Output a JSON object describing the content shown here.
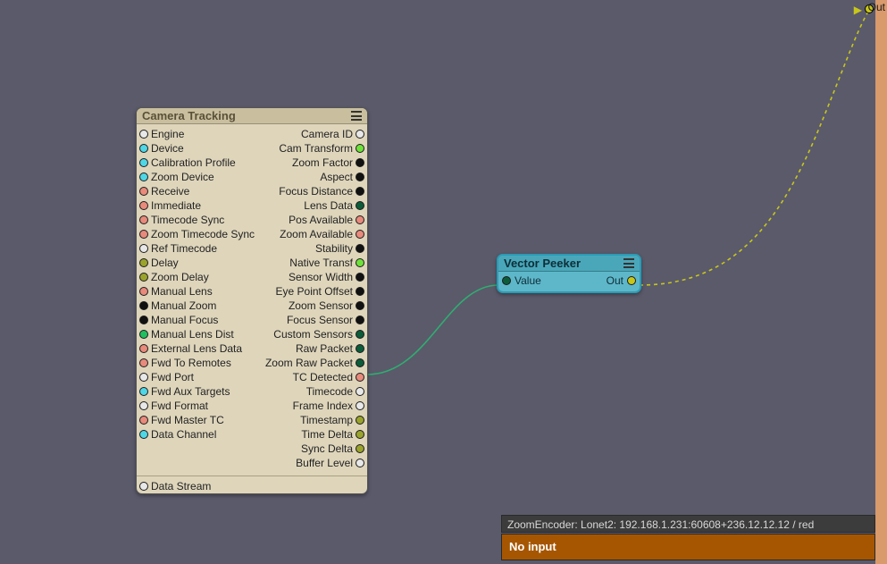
{
  "rail_out_label": "Out",
  "camera": {
    "title": "Camera Tracking",
    "rows": [
      {
        "l": "Engine",
        "lc": "white",
        "r": "Camera ID",
        "rc": "white"
      },
      {
        "l": "Device",
        "lc": "cyan",
        "r": "Cam Transform",
        "rc": "lime"
      },
      {
        "l": "Calibration Profile",
        "lc": "cyan",
        "r": "Zoom Factor",
        "rc": "black"
      },
      {
        "l": "Zoom Device",
        "lc": "cyan",
        "r": "Aspect",
        "rc": "black"
      },
      {
        "l": "Receive",
        "lc": "salmon",
        "r": "Focus Distance",
        "rc": "black"
      },
      {
        "l": "Immediate",
        "lc": "salmon",
        "r": "Lens Data",
        "rc": "dgreen"
      },
      {
        "l": "Timecode Sync",
        "lc": "salmon",
        "r": "Pos Available",
        "rc": "salmon"
      },
      {
        "l": "Zoom Timecode Sync",
        "lc": "salmon",
        "r": "Zoom Available",
        "rc": "salmon"
      },
      {
        "l": "Ref Timecode",
        "lc": "white",
        "r": "Stability",
        "rc": "black"
      },
      {
        "l": "Delay",
        "lc": "olive",
        "r": "Native Transf",
        "rc": "lime"
      },
      {
        "l": "Zoom Delay",
        "lc": "olive",
        "r": "Sensor Width",
        "rc": "black"
      },
      {
        "l": "Manual Lens",
        "lc": "salmon",
        "r": "Eye Point Offset",
        "rc": "black"
      },
      {
        "l": "Manual Zoom",
        "lc": "black",
        "r": "Zoom Sensor",
        "rc": "black"
      },
      {
        "l": "Manual Focus",
        "lc": "black",
        "r": "Focus Sensor",
        "rc": "black"
      },
      {
        "l": "Manual Lens Dist",
        "lc": "green",
        "r": "Custom Sensors",
        "rc": "dgreen"
      },
      {
        "l": "External Lens Data",
        "lc": "salmon",
        "r": "Raw Packet",
        "rc": "dgreen"
      },
      {
        "l": "Fwd To Remotes",
        "lc": "salmon",
        "r": "Zoom Raw Packet",
        "rc": "dgreen"
      },
      {
        "l": "Fwd Port",
        "lc": "white",
        "r": "TC Detected",
        "rc": "salmon"
      },
      {
        "l": "Fwd Aux Targets",
        "lc": "cyan",
        "r": "Timecode",
        "rc": "white"
      },
      {
        "l": "Fwd Format",
        "lc": "white",
        "r": "Frame Index",
        "rc": "white"
      },
      {
        "l": "Fwd Master TC",
        "lc": "salmon",
        "r": "Timestamp",
        "rc": "olive"
      },
      {
        "l": "Data Channel",
        "lc": "cyan",
        "r": "Time Delta",
        "rc": "olive"
      },
      {
        "l": "",
        "lc": "",
        "r": "Sync Delta",
        "rc": "olive"
      },
      {
        "l": "",
        "lc": "",
        "r": "Buffer Level",
        "rc": "white"
      }
    ],
    "footer_label": "Data Stream",
    "footer_color": "white"
  },
  "peeker": {
    "title": "Vector Peeker",
    "in_label": "Value",
    "in_color": "dgreen",
    "out_label": "Out",
    "out_color": "yellow"
  },
  "status_line": "ZoomEncoder: Lonet2: 192.168.1.231:60608+236.12.12.12 / red",
  "alert_line": "No input"
}
